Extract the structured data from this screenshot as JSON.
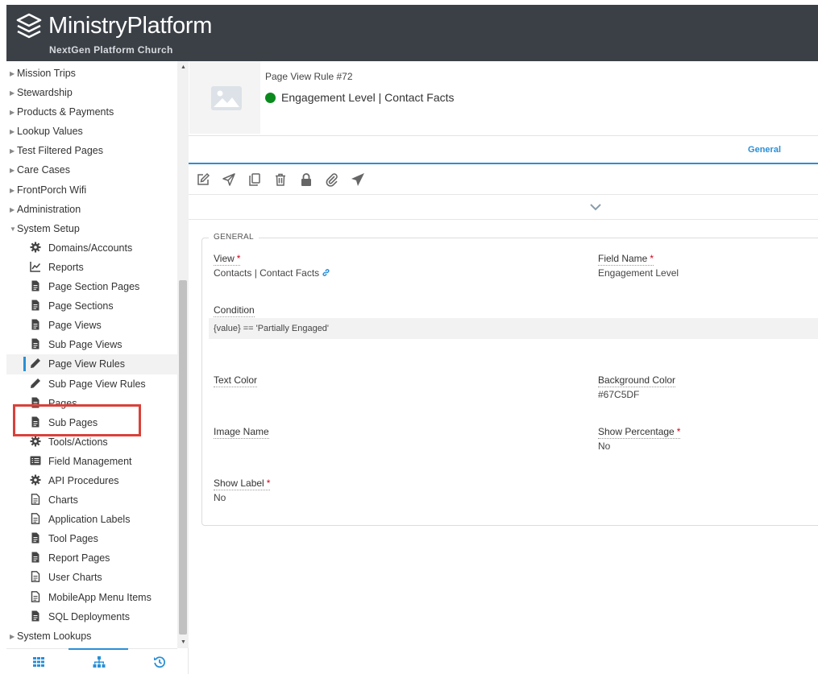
{
  "header": {
    "brand": "MinistryPlatform",
    "subbrand": "NextGen Platform Church"
  },
  "sidebar": {
    "items": [
      {
        "label": "Mission Trips",
        "type": "top",
        "caret": "right"
      },
      {
        "label": "Stewardship",
        "type": "top",
        "caret": "right"
      },
      {
        "label": "Products & Payments",
        "type": "top",
        "caret": "right"
      },
      {
        "label": "Lookup Values",
        "type": "top",
        "caret": "right"
      },
      {
        "label": "Test Filtered Pages",
        "type": "top",
        "caret": "right"
      },
      {
        "label": "Care Cases",
        "type": "top",
        "caret": "right"
      },
      {
        "label": "FrontPorch Wifi",
        "type": "top",
        "caret": "right"
      },
      {
        "label": "Administration",
        "type": "top",
        "caret": "right"
      },
      {
        "label": "System Setup",
        "type": "top",
        "caret": "down"
      },
      {
        "label": "Domains/Accounts",
        "type": "child",
        "icon": "gear-icon"
      },
      {
        "label": "Reports",
        "type": "child",
        "icon": "chart-line-icon"
      },
      {
        "label": "Page Section Pages",
        "type": "child",
        "icon": "file-icon"
      },
      {
        "label": "Page Sections",
        "type": "child",
        "icon": "file-icon"
      },
      {
        "label": "Page Views",
        "type": "child",
        "icon": "file-icon"
      },
      {
        "label": "Sub Page Views",
        "type": "child",
        "icon": "file-icon"
      },
      {
        "label": "Page View Rules",
        "type": "child",
        "icon": "pencil-icon",
        "active": true
      },
      {
        "label": "Sub Page View Rules",
        "type": "child",
        "icon": "pencil-icon"
      },
      {
        "label": "Pages",
        "type": "child",
        "icon": "file-icon"
      },
      {
        "label": "Sub Pages",
        "type": "child",
        "icon": "file-icon"
      },
      {
        "label": "Tools/Actions",
        "type": "child",
        "icon": "gear-icon"
      },
      {
        "label": "Field Management",
        "type": "child",
        "icon": "list-icon"
      },
      {
        "label": "API Procedures",
        "type": "child",
        "icon": "gear-icon"
      },
      {
        "label": "Charts",
        "type": "child",
        "icon": "file-outline-icon"
      },
      {
        "label": "Application Labels",
        "type": "child",
        "icon": "file-outline-icon"
      },
      {
        "label": "Tool Pages",
        "type": "child",
        "icon": "file-icon"
      },
      {
        "label": "Report Pages",
        "type": "child",
        "icon": "file-icon"
      },
      {
        "label": "User Charts",
        "type": "child",
        "icon": "file-outline-icon"
      },
      {
        "label": "MobileApp Menu Items",
        "type": "child",
        "icon": "file-outline-icon"
      },
      {
        "label": "SQL Deployments",
        "type": "child",
        "icon": "file-icon"
      },
      {
        "label": "System Lookups",
        "type": "top",
        "caret": "right"
      }
    ],
    "footer": [
      "grid-icon",
      "sitemap-icon",
      "history-icon"
    ]
  },
  "record": {
    "subtitle": "Page View Rule #72",
    "title": "Engagement Level | Contact Facts",
    "status_color": "#0a8a1d"
  },
  "tabs": {
    "general": "General"
  },
  "toolbar": [
    "edit-icon",
    "send-icon",
    "copy-icon",
    "delete-icon",
    "lock-icon",
    "attach-icon",
    "paper-plane-icon"
  ],
  "form": {
    "legend": "GENERAL",
    "view_label": "View",
    "view_value": "Contacts | Contact Facts",
    "field_name_label": "Field Name",
    "field_name_value": "Engagement Level",
    "condition_label": "Condition",
    "condition_value": "{value} == 'Partially Engaged'",
    "text_color_label": "Text Color",
    "background_color_label": "Background Color",
    "background_color_value": "#67C5DF",
    "image_name_label": "Image Name",
    "show_percentage_label": "Show Percentage",
    "show_percentage_value": "No",
    "show_label_label": "Show Label",
    "show_label_value": "No",
    "required_mark": "*"
  },
  "colors": {
    "header_bg": "#3b4047",
    "accent": "#2a8fd6",
    "highlight": "#d9413a"
  }
}
